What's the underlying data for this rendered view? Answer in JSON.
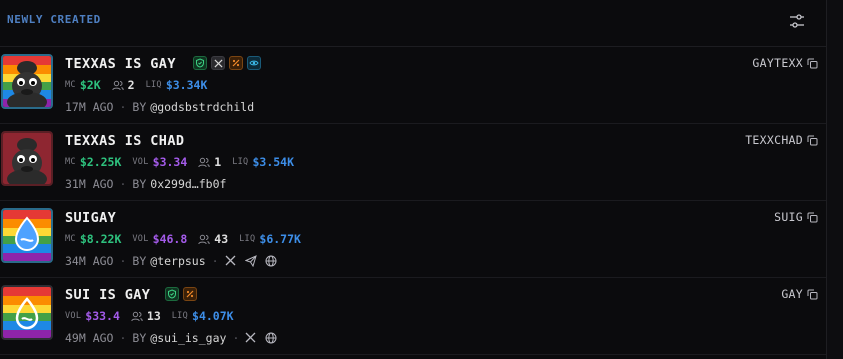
{
  "header": {
    "title": "NEWLY CREATED",
    "filter_icon": "sliders-icon"
  },
  "labels": {
    "mc": "MC",
    "vol": "VOL",
    "liq": "LIQ",
    "by": "BY",
    "sep": "·"
  },
  "colors": {
    "green": "#2ec27e",
    "purple": "#a45bea",
    "blue": "#3d8ee8",
    "header": "#4e7fc1"
  },
  "tokens": [
    {
      "name": "TEXXAS IS GAY",
      "ticker": "GAYTEXX",
      "badges": [
        "shield-icon",
        "x-icon",
        "percent-icon",
        "eye-icon"
      ],
      "mc": "$2K",
      "holders": "2",
      "liq": "$3.34K",
      "age": "17M AGO",
      "creator": "@godsbstrdchild",
      "socials": []
    },
    {
      "name": "TEXXAS IS CHAD",
      "ticker": "TEXXCHAD",
      "badges": [],
      "mc": "$2.25K",
      "vol": "$3.34",
      "holders": "1",
      "liq": "$3.54K",
      "age": "31M AGO",
      "creator": "0x299d…fb0f",
      "socials": []
    },
    {
      "name": "SUIGAY",
      "ticker": "SUIG",
      "badges": [],
      "mc": "$8.22K",
      "vol": "$46.8",
      "holders": "43",
      "liq": "$6.77K",
      "age": "34M AGO",
      "creator": "@terpsus",
      "socials": [
        "x-icon",
        "telegram-icon",
        "globe-icon"
      ]
    },
    {
      "name": "SUI IS GAY",
      "ticker": "GAY",
      "badges": [
        "shield-icon",
        "percent-icon"
      ],
      "vol": "$33.4",
      "holders": "13",
      "liq": "$4.07K",
      "age": "49M AGO",
      "creator": "@sui_is_gay",
      "socials": [
        "x-icon",
        "globe-icon"
      ]
    }
  ]
}
